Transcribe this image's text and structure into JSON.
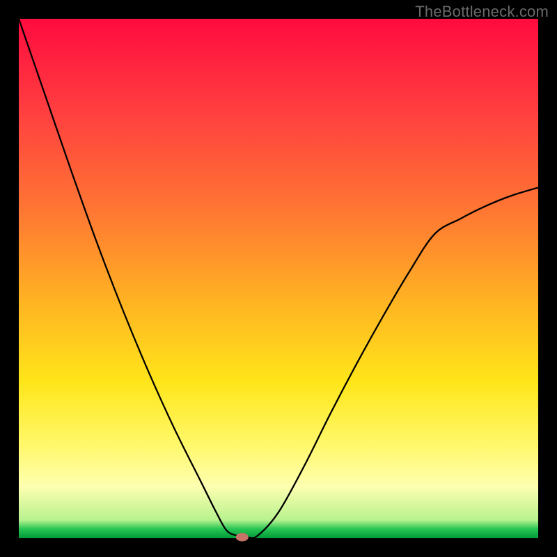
{
  "watermark": {
    "text": "TheBottleneck.com"
  },
  "marker": {
    "color": "#c77368"
  },
  "chart_data": {
    "type": "line",
    "title": "",
    "xlabel": "",
    "ylabel": "",
    "xlim": [
      0,
      100
    ],
    "ylim": [
      0,
      100
    ],
    "grid": false,
    "series": [
      {
        "name": "bottleneck-curve",
        "x": [
          0,
          5,
          10,
          15,
          20,
          25,
          30,
          35,
          38,
          40,
          42,
          44,
          46,
          50,
          55,
          60,
          65,
          70,
          75,
          80,
          85,
          90,
          95,
          100
        ],
        "y": [
          100,
          85.5,
          71,
          57,
          44,
          32,
          21,
          11,
          5,
          1.5,
          0.5,
          0.2,
          0.5,
          5,
          14,
          24,
          33.5,
          42.5,
          51,
          58.5,
          61.5,
          64,
          66,
          67.5
        ]
      }
    ],
    "annotations": [
      {
        "type": "marker",
        "x": 43,
        "y": 0.2,
        "label": "optimal-point"
      }
    ]
  }
}
